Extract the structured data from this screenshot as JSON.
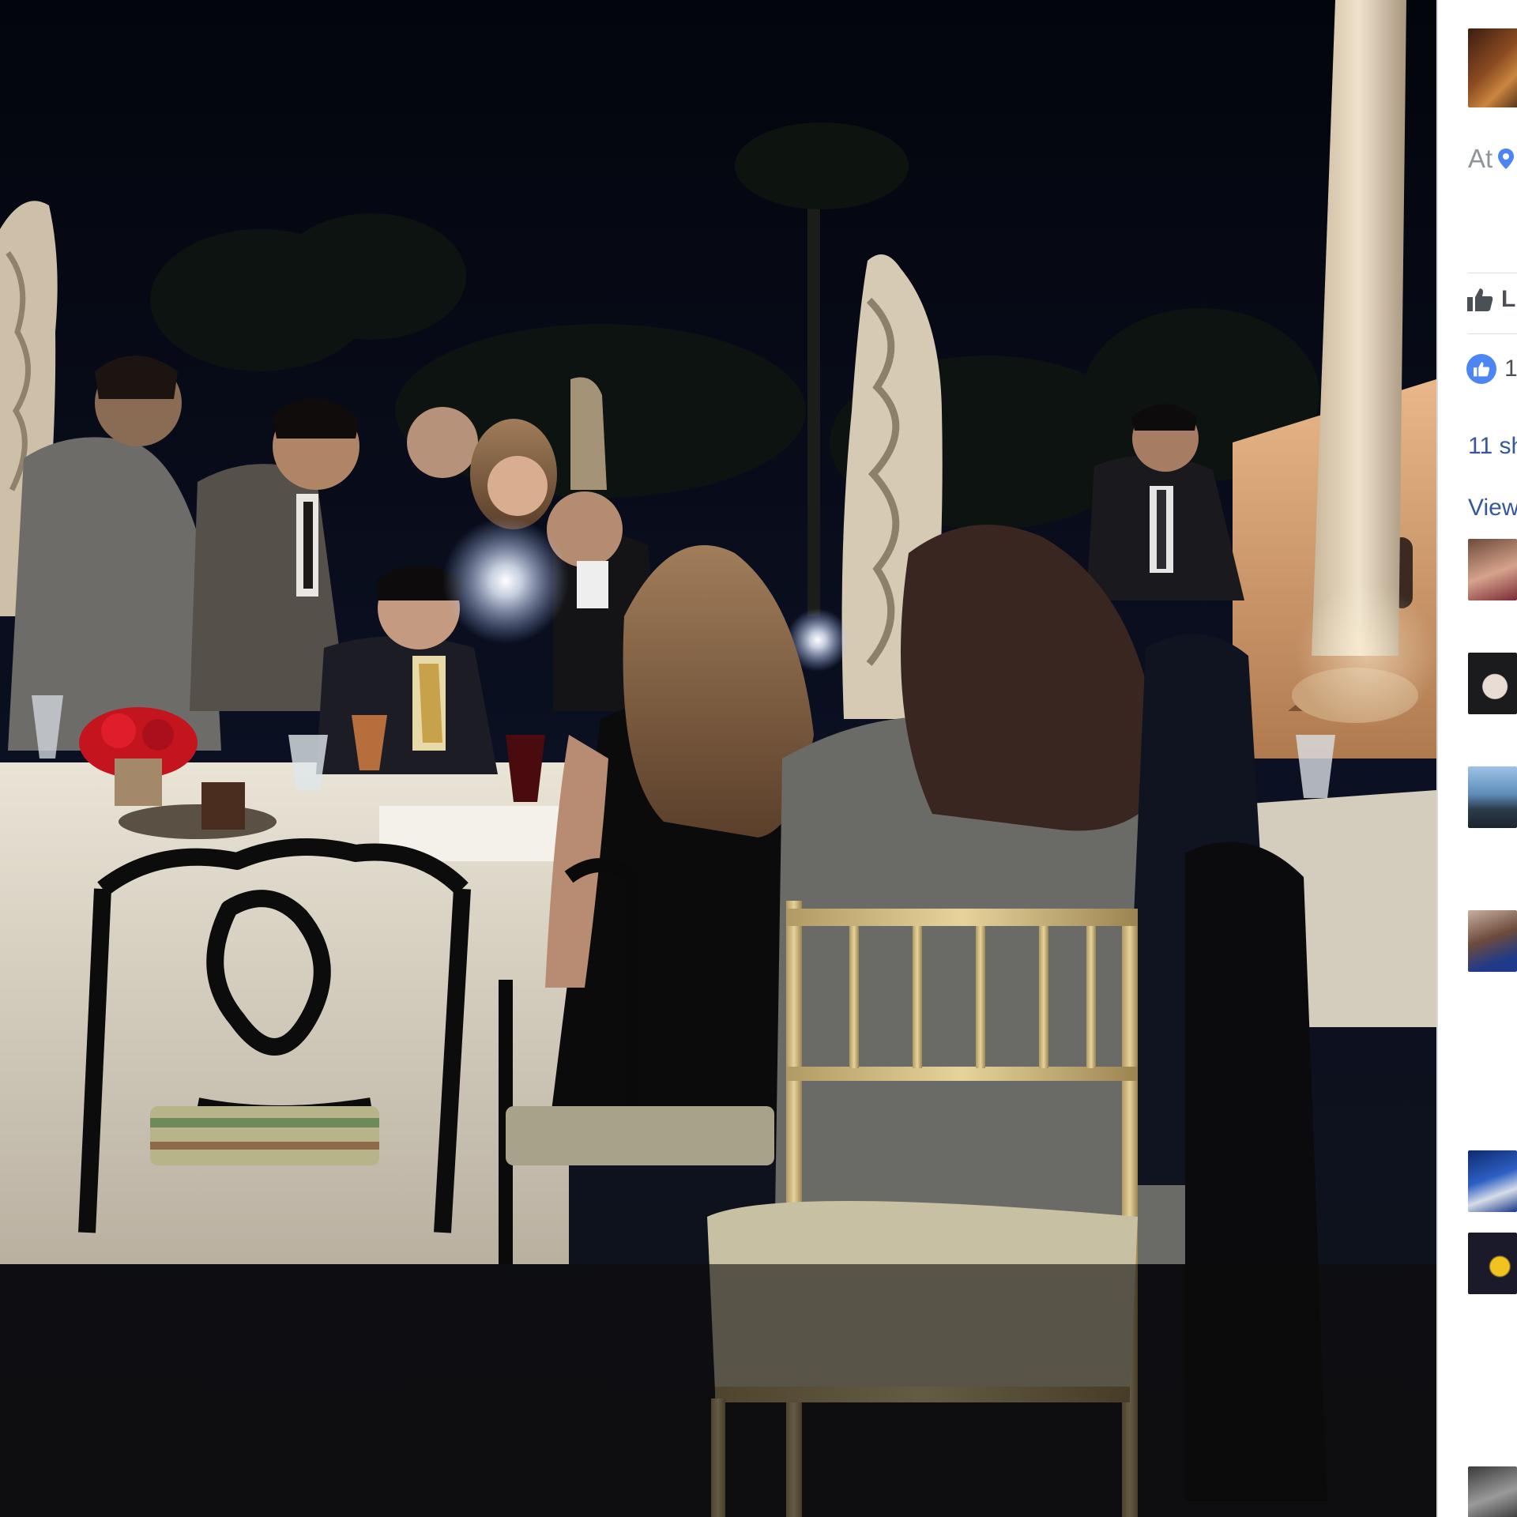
{
  "photo": {
    "subject": "photo"
  },
  "side_panel": {
    "location_prefix": "At",
    "location_icon": "map-pin-icon",
    "like_button_label": "L",
    "like_button_icon": "thumbs-up-icon",
    "like_count_text": "1",
    "reaction_icon": "like-reaction-icon",
    "shares_text": "11 sh",
    "view_more_text": "View",
    "link_color": "#365899",
    "muted_color": "#90949c",
    "reaction_color": "#4c86f5"
  }
}
